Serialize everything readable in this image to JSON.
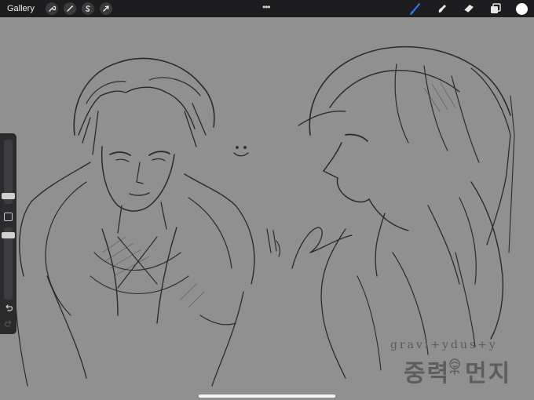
{
  "topbar": {
    "gallery_label": "Gallery",
    "left_tools": [
      {
        "name": "actions",
        "icon": "wrench-icon"
      },
      {
        "name": "adjustments",
        "icon": "magic-wand-icon"
      },
      {
        "name": "selection",
        "icon": "selection-s-icon"
      },
      {
        "name": "transform",
        "icon": "arrow-cursor-icon"
      }
    ],
    "more_label": "•••",
    "right_tools": [
      {
        "name": "brush",
        "icon": "brush-icon",
        "active": true
      },
      {
        "name": "smudge",
        "icon": "smudge-icon"
      },
      {
        "name": "eraser",
        "icon": "eraser-icon"
      },
      {
        "name": "layers",
        "icon": "layers-icon"
      }
    ],
    "active_color": "#ffffff",
    "accent_color": "#2f7cf6"
  },
  "sidebar": {
    "brush_size_level": 0.45,
    "opacity_level": 0.4,
    "modify_icon": "square-icon",
    "undo_icon": "undo-icon",
    "redo_icon": "redo-icon"
  },
  "watermark": {
    "latin": "gravi+ydus+y",
    "korean_left": "중력",
    "korean_right": "먼지",
    "emblem": "rose-icon"
  }
}
